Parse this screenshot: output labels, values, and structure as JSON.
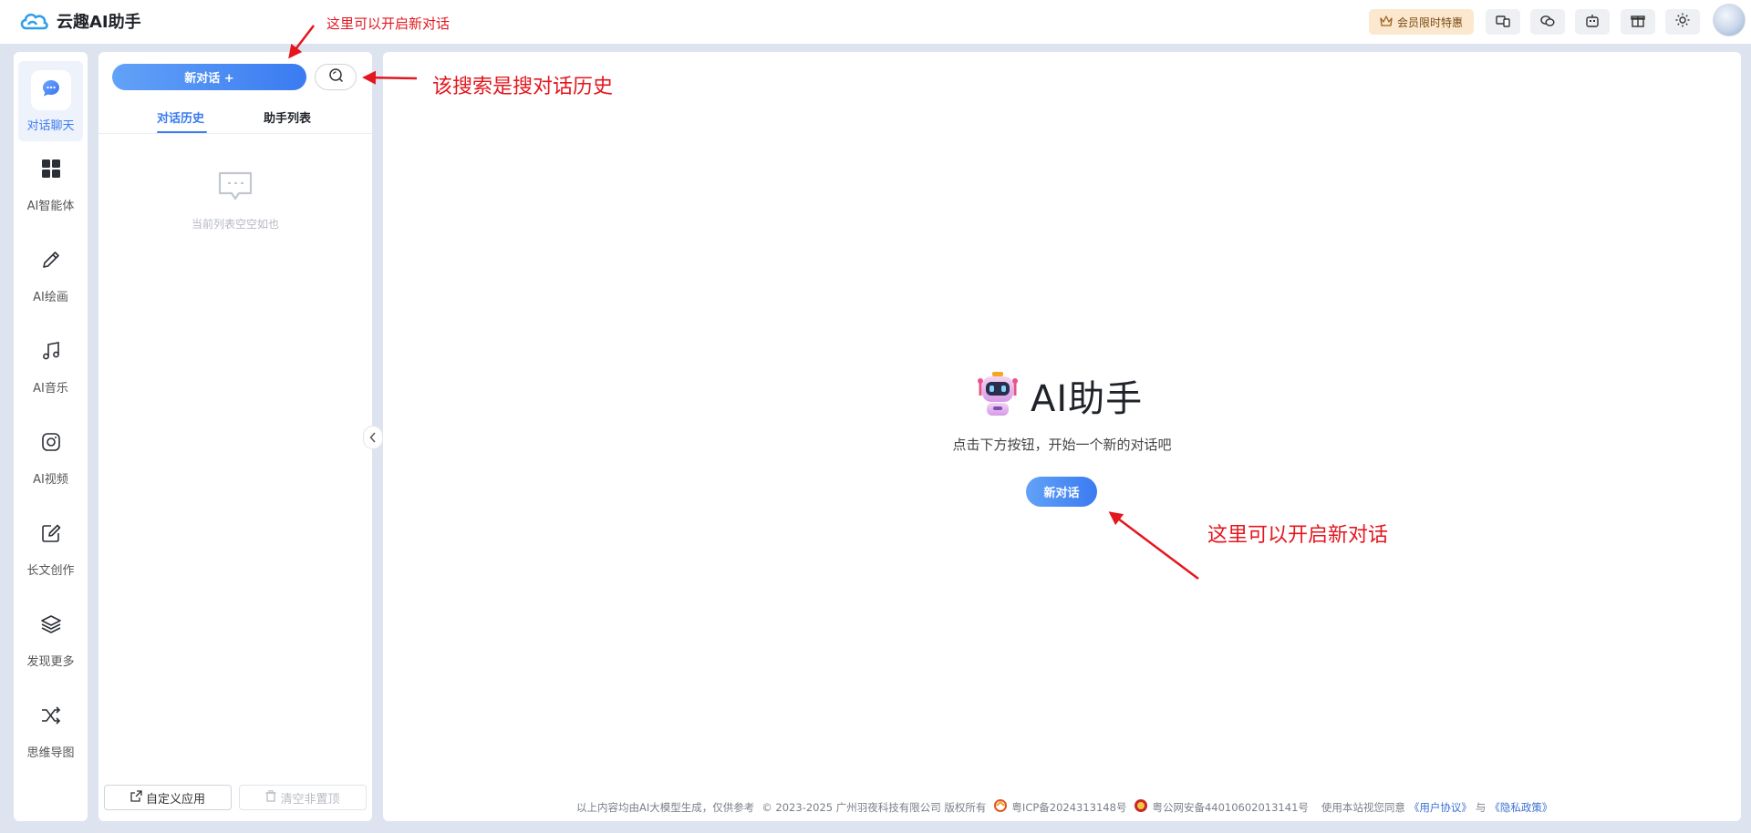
{
  "header": {
    "app_name": "云趣AI助手",
    "vip_label": "会员限时特惠",
    "icons": [
      "device-switch-icon",
      "wechat-icon",
      "robot-icon",
      "gift-icon",
      "theme-sun-icon"
    ]
  },
  "leftnav": {
    "items": [
      {
        "label": "对话聊天",
        "icon": "chat-bubble-icon",
        "active": true
      },
      {
        "label": "AI智能体",
        "icon": "grid-icon"
      },
      {
        "label": "AI绘画",
        "icon": "pencil-icon"
      },
      {
        "label": "AI音乐",
        "icon": "music-note-icon"
      },
      {
        "label": "AI视频",
        "icon": "camera-icon"
      },
      {
        "label": "长文创作",
        "icon": "edit-square-icon"
      },
      {
        "label": "发现更多",
        "icon": "layers-icon"
      },
      {
        "label": "思维导图",
        "icon": "shuffle-icon"
      }
    ]
  },
  "history": {
    "new_chat_label": "新对话 +",
    "tabs": [
      "对话历史",
      "助手列表"
    ],
    "empty_text": "当前列表空空如也",
    "custom_app_label": "自定义应用",
    "clear_label": "清空非置顶"
  },
  "main": {
    "title": "AI助手",
    "subtitle": "点击下方按钮，开始一个新的对话吧",
    "button_label": "新对话"
  },
  "footer": {
    "disclaimer": "以上内容均由AI大模型生成，仅供参考",
    "copyright": "© 2023-2025 广州羽夜科技有限公司 版权所有",
    "icp": "粤ICP备2024313148号",
    "police": "粤公网安备44010602013141号",
    "agree_prefix": "使用本站视您同意",
    "user_agreement": "《用户协议》",
    "and": "与",
    "privacy": "《隐私政策》"
  },
  "annotations": {
    "top": "这里可以开启新对话",
    "search": "该搜索是搜对话历史",
    "main": "这里可以开启新对话"
  },
  "colors": {
    "accent": "#3b7cf0",
    "annotation": "#e4161e",
    "vip_bg": "#fbe8cf"
  }
}
